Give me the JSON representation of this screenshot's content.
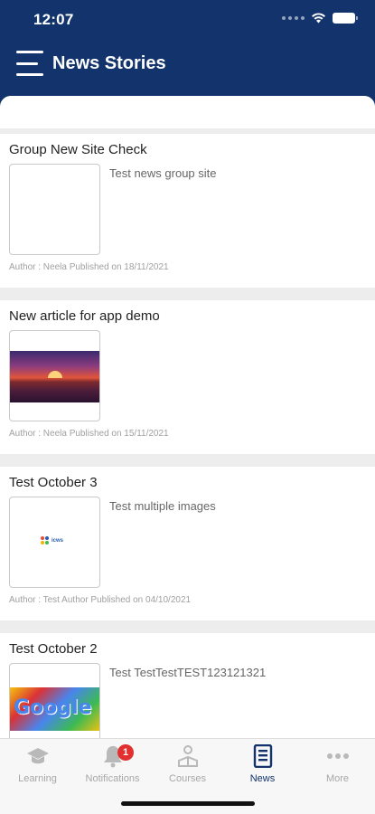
{
  "status": {
    "time": "12:07"
  },
  "header": {
    "title": "News Stories"
  },
  "stories": [
    {
      "title": "Group New Site Check",
      "description": "Test news group site",
      "meta": "Author : Neela Published on 18/11/2021"
    },
    {
      "title": "New article for app demo",
      "description": "",
      "meta": "Author : Neela Published on 15/11/2021"
    },
    {
      "title": "Test October 3",
      "description": "Test multiple images",
      "meta": "Author : Test Author Published on 04/10/2021",
      "logo_text": "icws"
    },
    {
      "title": "Test October 2",
      "description": "Test TestTestTEST123121321",
      "meta": "",
      "image_text": "Google"
    }
  ],
  "tabs": [
    {
      "label": "Learning"
    },
    {
      "label": "Notifications",
      "badge": "1"
    },
    {
      "label": "Courses"
    },
    {
      "label": "News"
    },
    {
      "label": "More"
    }
  ],
  "colors": {
    "primary": "#12336b",
    "badge": "#e23030",
    "inactive": "#a7a7a7"
  }
}
